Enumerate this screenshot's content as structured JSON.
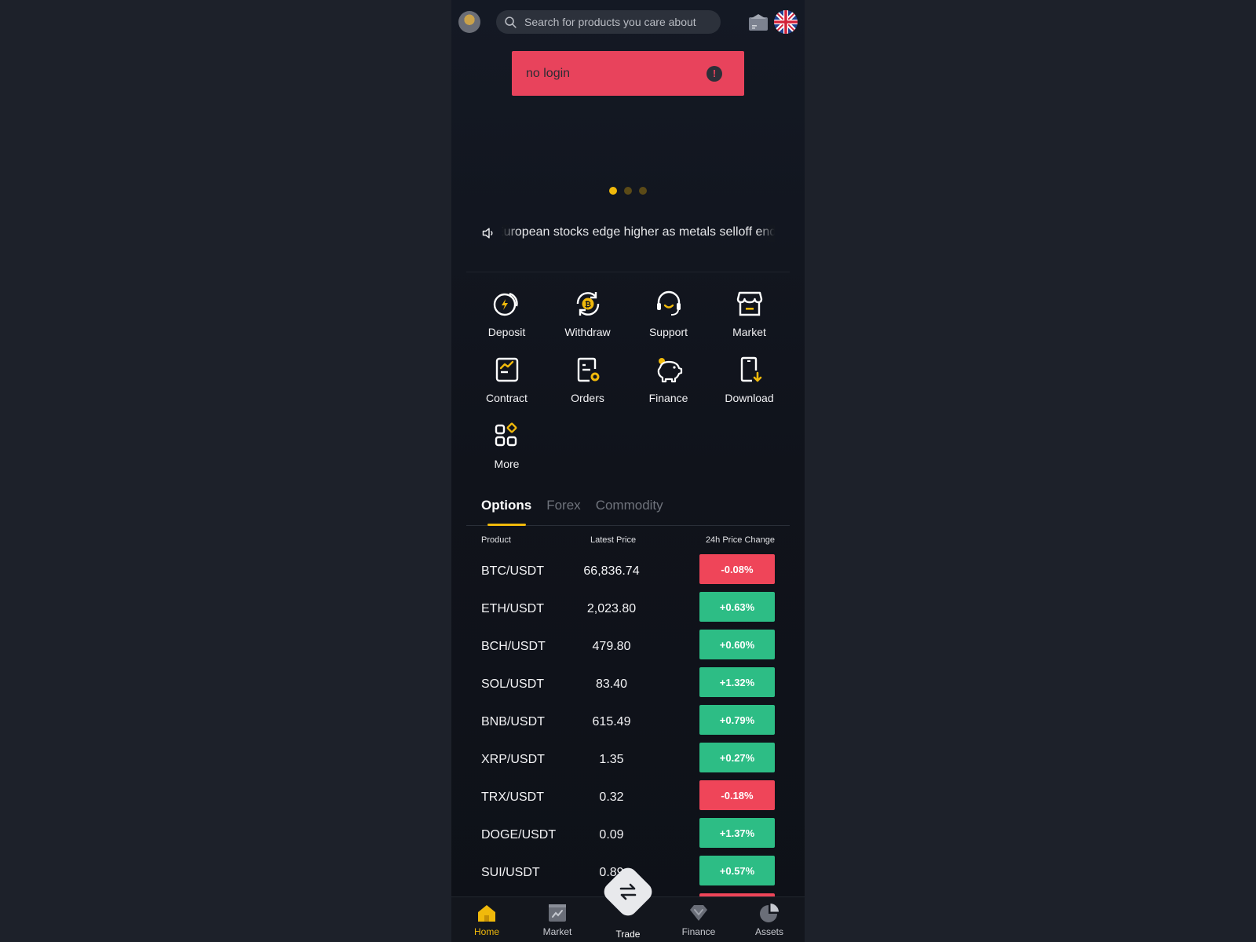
{
  "header": {
    "search_placeholder": "Search for products you care about"
  },
  "toast": {
    "message": "no login",
    "icon": "!"
  },
  "carousel": {
    "dots": 3,
    "active_index": 0
  },
  "notice": {
    "text": "European stocks edge higher as metals selloff ends; P"
  },
  "quick_actions": [
    {
      "label": "Deposit",
      "icon": "deposit-icon"
    },
    {
      "label": "Withdraw",
      "icon": "withdraw-icon"
    },
    {
      "label": "Support",
      "icon": "support-icon"
    },
    {
      "label": "Market",
      "icon": "market-icon"
    },
    {
      "label": "Contract",
      "icon": "contract-icon"
    },
    {
      "label": "Orders",
      "icon": "orders-icon"
    },
    {
      "label": "Finance",
      "icon": "finance-icon"
    },
    {
      "label": "Download",
      "icon": "download-icon"
    },
    {
      "label": "More",
      "icon": "more-icon"
    }
  ],
  "tabs": [
    {
      "label": "Options",
      "active": true
    },
    {
      "label": "Forex",
      "active": false
    },
    {
      "label": "Commodity",
      "active": false
    }
  ],
  "table": {
    "headers": {
      "product": "Product",
      "price": "Latest Price",
      "change": "24h Price Change"
    },
    "rows": [
      {
        "pair": "BTC/USDT",
        "price": "66,836.74",
        "change": "-0.08%"
      },
      {
        "pair": "ETH/USDT",
        "price": "2,023.80",
        "change": "+0.63%"
      },
      {
        "pair": "BCH/USDT",
        "price": "479.80",
        "change": "+0.60%"
      },
      {
        "pair": "SOL/USDT",
        "price": "83.40",
        "change": "+1.32%"
      },
      {
        "pair": "BNB/USDT",
        "price": "615.49",
        "change": "+0.79%"
      },
      {
        "pair": "XRP/USDT",
        "price": "1.35",
        "change": "+0.27%"
      },
      {
        "pair": "TRX/USDT",
        "price": "0.32",
        "change": "-0.18%"
      },
      {
        "pair": "DOGE/USDT",
        "price": "0.09",
        "change": "+1.37%"
      },
      {
        "pair": "SUI/USDT",
        "price": "0.89",
        "change": "+0.57%"
      }
    ]
  },
  "bottom_nav": [
    {
      "label": "Home",
      "icon": "home-icon",
      "active": true
    },
    {
      "label": "Market",
      "icon": "market-chart-icon",
      "active": false
    },
    {
      "label": "Trade",
      "icon": "swap-icon",
      "active": false
    },
    {
      "label": "Finance",
      "icon": "diamond-icon",
      "active": false
    },
    {
      "label": "Assets",
      "icon": "pie-chart-icon",
      "active": false
    }
  ],
  "colors": {
    "accent": "#f0b90b",
    "positive": "#2dbd85",
    "negative": "#ef4559",
    "toast": "#e8435c"
  }
}
